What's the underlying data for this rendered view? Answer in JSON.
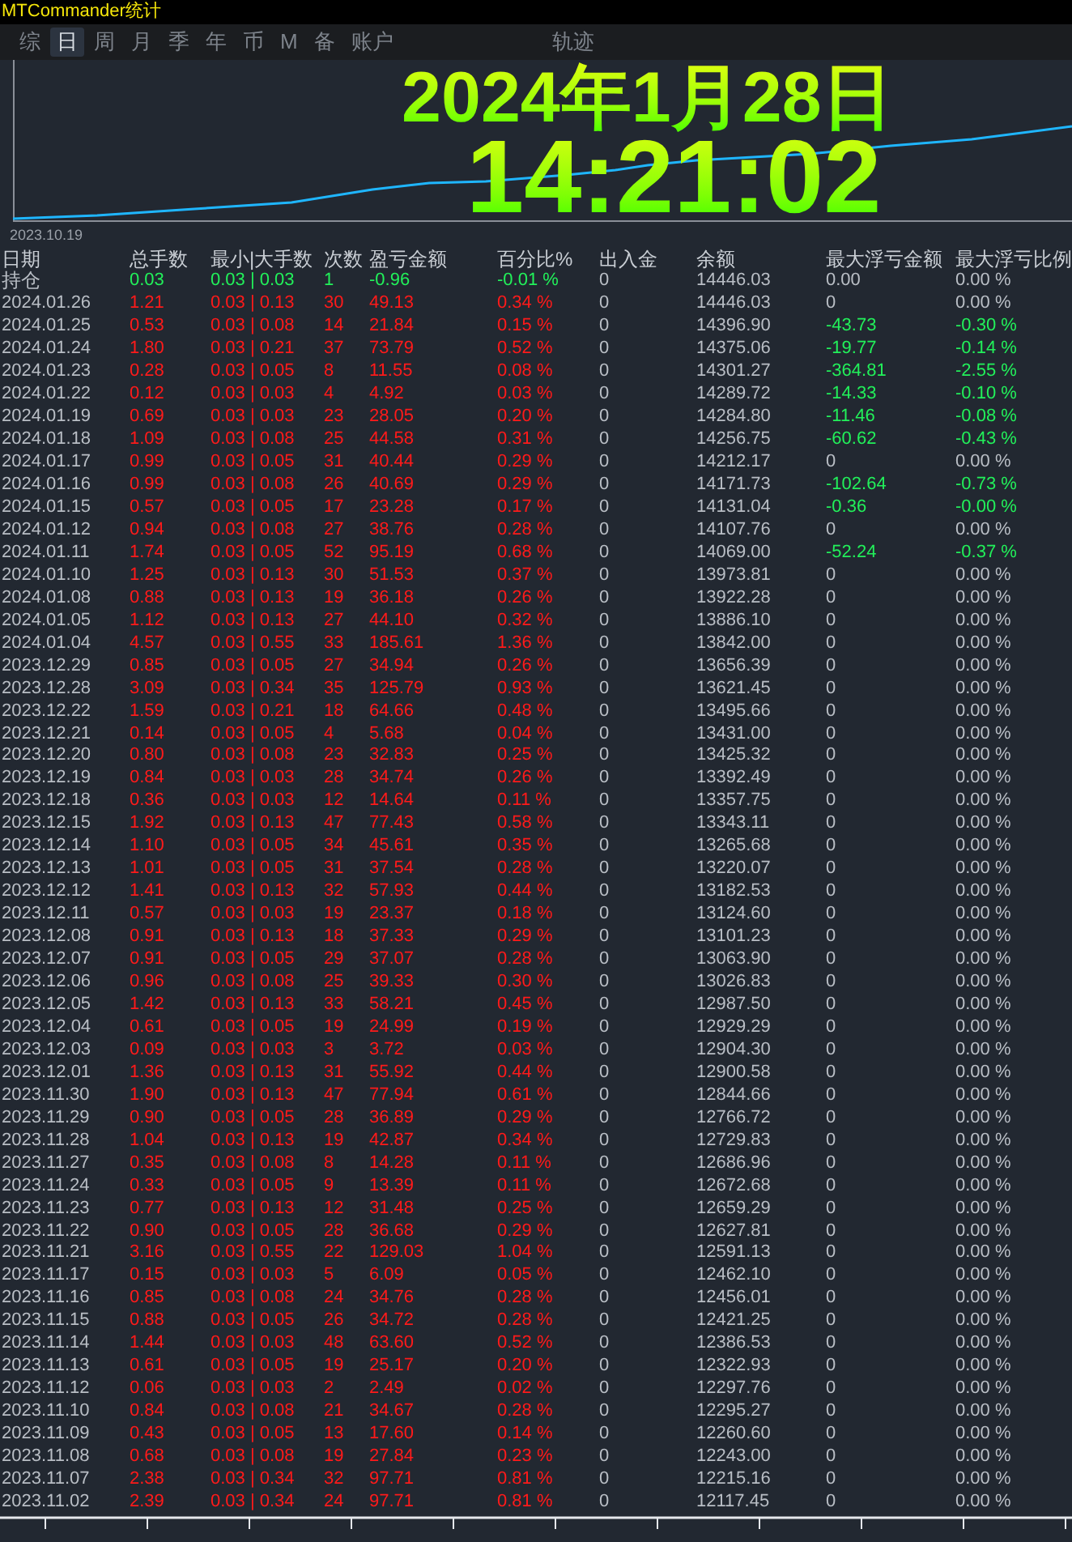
{
  "window": {
    "title": "MTCommander统计"
  },
  "tabs": [
    {
      "label": "综",
      "selected": false
    },
    {
      "label": "日",
      "selected": true
    },
    {
      "label": "周",
      "selected": false
    },
    {
      "label": "月",
      "selected": false
    },
    {
      "label": "季",
      "selected": false
    },
    {
      "label": "年",
      "selected": false
    },
    {
      "label": "币",
      "selected": false
    },
    {
      "label": "M",
      "selected": false
    },
    {
      "label": "备",
      "selected": false
    },
    {
      "label": "账户",
      "selected": false
    },
    {
      "label": "轨迹",
      "selected": false
    }
  ],
  "chart": {
    "start_label": "2023.10.19",
    "date": "2024年1月28日",
    "time": "14:21:02"
  },
  "table": {
    "columns": [
      "日期",
      "总手数",
      "最小|大手数",
      "次数",
      "盈亏金额",
      "百分比%",
      "出入金",
      "余额",
      "最大浮亏金额",
      "最大浮亏比例"
    ],
    "rows": [
      {
        "kind": "position",
        "drawdown": false,
        "cells": [
          "持仓",
          "0.03",
          "0.03 | 0.03",
          "1",
          "-0.96",
          "-0.01 %",
          "0",
          "14446.03",
          "0.00",
          "0.00 %"
        ]
      },
      {
        "kind": "day",
        "drawdown": false,
        "cells": [
          "2024.01.26",
          "1.21",
          "0.03 | 0.13",
          "30",
          "49.13",
          "0.34 %",
          "0",
          "14446.03",
          "0",
          "0.00 %"
        ]
      },
      {
        "kind": "day",
        "drawdown": true,
        "cells": [
          "2024.01.25",
          "0.53",
          "0.03 | 0.08",
          "14",
          "21.84",
          "0.15 %",
          "0",
          "14396.90",
          "-43.73",
          "-0.30 %"
        ]
      },
      {
        "kind": "day",
        "drawdown": true,
        "cells": [
          "2024.01.24",
          "1.80",
          "0.03 | 0.21",
          "37",
          "73.79",
          "0.52 %",
          "0",
          "14375.06",
          "-19.77",
          "-0.14 %"
        ]
      },
      {
        "kind": "day",
        "drawdown": true,
        "cells": [
          "2024.01.23",
          "0.28",
          "0.03 | 0.05",
          "8",
          "11.55",
          "0.08 %",
          "0",
          "14301.27",
          "-364.81",
          "-2.55 %"
        ]
      },
      {
        "kind": "day",
        "drawdown": true,
        "cells": [
          "2024.01.22",
          "0.12",
          "0.03 | 0.03",
          "4",
          "4.92",
          "0.03 %",
          "0",
          "14289.72",
          "-14.33",
          "-0.10 %"
        ]
      },
      {
        "kind": "day",
        "drawdown": true,
        "cells": [
          "2024.01.19",
          "0.69",
          "0.03 | 0.03",
          "23",
          "28.05",
          "0.20 %",
          "0",
          "14284.80",
          "-11.46",
          "-0.08 %"
        ]
      },
      {
        "kind": "day",
        "drawdown": true,
        "cells": [
          "2024.01.18",
          "1.09",
          "0.03 | 0.08",
          "25",
          "44.58",
          "0.31 %",
          "0",
          "14256.75",
          "-60.62",
          "-0.43 %"
        ]
      },
      {
        "kind": "day",
        "drawdown": false,
        "cells": [
          "2024.01.17",
          "0.99",
          "0.03 | 0.05",
          "31",
          "40.44",
          "0.29 %",
          "0",
          "14212.17",
          "0",
          "0.00 %"
        ]
      },
      {
        "kind": "day",
        "drawdown": true,
        "cells": [
          "2024.01.16",
          "0.99",
          "0.03 | 0.08",
          "26",
          "40.69",
          "0.29 %",
          "0",
          "14171.73",
          "-102.64",
          "-0.73 %"
        ]
      },
      {
        "kind": "day",
        "drawdown": true,
        "cells": [
          "2024.01.15",
          "0.57",
          "0.03 | 0.05",
          "17",
          "23.28",
          "0.17 %",
          "0",
          "14131.04",
          "-0.36",
          "-0.00 %"
        ]
      },
      {
        "kind": "day",
        "drawdown": false,
        "cells": [
          "2024.01.12",
          "0.94",
          "0.03 | 0.08",
          "27",
          "38.76",
          "0.28 %",
          "0",
          "14107.76",
          "0",
          "0.00 %"
        ]
      },
      {
        "kind": "day",
        "drawdown": true,
        "cells": [
          "2024.01.11",
          "1.74",
          "0.03 | 0.05",
          "52",
          "95.19",
          "0.68 %",
          "0",
          "14069.00",
          "-52.24",
          "-0.37 %"
        ]
      },
      {
        "kind": "day",
        "drawdown": false,
        "cells": [
          "2024.01.10",
          "1.25",
          "0.03 | 0.13",
          "30",
          "51.53",
          "0.37 %",
          "0",
          "13973.81",
          "0",
          "0.00 %"
        ]
      },
      {
        "kind": "day",
        "drawdown": false,
        "cells": [
          "2024.01.08",
          "0.88",
          "0.03 | 0.13",
          "19",
          "36.18",
          "0.26 %",
          "0",
          "13922.28",
          "0",
          "0.00 %"
        ]
      },
      {
        "kind": "day",
        "drawdown": false,
        "cells": [
          "2024.01.05",
          "1.12",
          "0.03 | 0.13",
          "27",
          "44.10",
          "0.32 %",
          "0",
          "13886.10",
          "0",
          "0.00 %"
        ]
      },
      {
        "kind": "day",
        "drawdown": false,
        "cells": [
          "2024.01.04",
          "4.57",
          "0.03 | 0.55",
          "33",
          "185.61",
          "1.36 %",
          "0",
          "13842.00",
          "0",
          "0.00 %"
        ]
      },
      {
        "kind": "day",
        "drawdown": false,
        "cells": [
          "2023.12.29",
          "0.85",
          "0.03 | 0.05",
          "27",
          "34.94",
          "0.26 %",
          "0",
          "13656.39",
          "0",
          "0.00 %"
        ]
      },
      {
        "kind": "day",
        "drawdown": false,
        "cells": [
          "2023.12.28",
          "3.09",
          "0.03 | 0.34",
          "35",
          "125.79",
          "0.93 %",
          "0",
          "13621.45",
          "0",
          "0.00 %"
        ]
      },
      {
        "kind": "day",
        "drawdown": false,
        "cells": [
          "2023.12.22",
          "1.59",
          "0.03 | 0.21",
          "18",
          "64.66",
          "0.48 %",
          "0",
          "13495.66",
          "0",
          "0.00 %"
        ]
      },
      {
        "kind": "day",
        "drawdown": false,
        "cells": [
          "2023.12.21",
          "0.14",
          "0.03 | 0.05",
          "4",
          "5.68",
          "0.04 %",
          "0",
          "13431.00",
          "0",
          "0.00 %"
        ]
      },
      {
        "kind": "day",
        "drawdown": false,
        "cells": [
          "2023.12.20",
          "0.80",
          "0.03 | 0.08",
          "23",
          "32.83",
          "0.25 %",
          "0",
          "13425.32",
          "0",
          "0.00 %"
        ]
      },
      {
        "kind": "day",
        "drawdown": false,
        "cells": [
          "2023.12.19",
          "0.84",
          "0.03 | 0.03",
          "28",
          "34.74",
          "0.26 %",
          "0",
          "13392.49",
          "0",
          "0.00 %"
        ]
      },
      {
        "kind": "day",
        "drawdown": false,
        "cells": [
          "2023.12.18",
          "0.36",
          "0.03 | 0.03",
          "12",
          "14.64",
          "0.11 %",
          "0",
          "13357.75",
          "0",
          "0.00 %"
        ]
      },
      {
        "kind": "day",
        "drawdown": false,
        "cells": [
          "2023.12.15",
          "1.92",
          "0.03 | 0.13",
          "47",
          "77.43",
          "0.58 %",
          "0",
          "13343.11",
          "0",
          "0.00 %"
        ]
      },
      {
        "kind": "day",
        "drawdown": false,
        "cells": [
          "2023.12.14",
          "1.10",
          "0.03 | 0.05",
          "34",
          "45.61",
          "0.35 %",
          "0",
          "13265.68",
          "0",
          "0.00 %"
        ]
      },
      {
        "kind": "day",
        "drawdown": false,
        "cells": [
          "2023.12.13",
          "1.01",
          "0.03 | 0.05",
          "31",
          "37.54",
          "0.28 %",
          "0",
          "13220.07",
          "0",
          "0.00 %"
        ]
      },
      {
        "kind": "day",
        "drawdown": false,
        "cells": [
          "2023.12.12",
          "1.41",
          "0.03 | 0.13",
          "32",
          "57.93",
          "0.44 %",
          "0",
          "13182.53",
          "0",
          "0.00 %"
        ]
      },
      {
        "kind": "day",
        "drawdown": false,
        "cells": [
          "2023.12.11",
          "0.57",
          "0.03 | 0.03",
          "19",
          "23.37",
          "0.18 %",
          "0",
          "13124.60",
          "0",
          "0.00 %"
        ]
      },
      {
        "kind": "day",
        "drawdown": false,
        "cells": [
          "2023.12.08",
          "0.91",
          "0.03 | 0.13",
          "18",
          "37.33",
          "0.29 %",
          "0",
          "13101.23",
          "0",
          "0.00 %"
        ]
      },
      {
        "kind": "day",
        "drawdown": false,
        "cells": [
          "2023.12.07",
          "0.91",
          "0.03 | 0.05",
          "29",
          "37.07",
          "0.28 %",
          "0",
          "13063.90",
          "0",
          "0.00 %"
        ]
      },
      {
        "kind": "day",
        "drawdown": false,
        "cells": [
          "2023.12.06",
          "0.96",
          "0.03 | 0.08",
          "25",
          "39.33",
          "0.30 %",
          "0",
          "13026.83",
          "0",
          "0.00 %"
        ]
      },
      {
        "kind": "day",
        "drawdown": false,
        "cells": [
          "2023.12.05",
          "1.42",
          "0.03 | 0.13",
          "33",
          "58.21",
          "0.45 %",
          "0",
          "12987.50",
          "0",
          "0.00 %"
        ]
      },
      {
        "kind": "day",
        "drawdown": false,
        "cells": [
          "2023.12.04",
          "0.61",
          "0.03 | 0.05",
          "19",
          "24.99",
          "0.19 %",
          "0",
          "12929.29",
          "0",
          "0.00 %"
        ]
      },
      {
        "kind": "day",
        "drawdown": false,
        "cells": [
          "2023.12.03",
          "0.09",
          "0.03 | 0.03",
          "3",
          "3.72",
          "0.03 %",
          "0",
          "12904.30",
          "0",
          "0.00 %"
        ]
      },
      {
        "kind": "day",
        "drawdown": false,
        "cells": [
          "2023.12.01",
          "1.36",
          "0.03 | 0.13",
          "31",
          "55.92",
          "0.44 %",
          "0",
          "12900.58",
          "0",
          "0.00 %"
        ]
      },
      {
        "kind": "day",
        "drawdown": false,
        "cells": [
          "2023.11.30",
          "1.90",
          "0.03 | 0.13",
          "47",
          "77.94",
          "0.61 %",
          "0",
          "12844.66",
          "0",
          "0.00 %"
        ]
      },
      {
        "kind": "day",
        "drawdown": false,
        "cells": [
          "2023.11.29",
          "0.90",
          "0.03 | 0.05",
          "28",
          "36.89",
          "0.29 %",
          "0",
          "12766.72",
          "0",
          "0.00 %"
        ]
      },
      {
        "kind": "day",
        "drawdown": false,
        "cells": [
          "2023.11.28",
          "1.04",
          "0.03 | 0.13",
          "19",
          "42.87",
          "0.34 %",
          "0",
          "12729.83",
          "0",
          "0.00 %"
        ]
      },
      {
        "kind": "day",
        "drawdown": false,
        "cells": [
          "2023.11.27",
          "0.35",
          "0.03 | 0.08",
          "8",
          "14.28",
          "0.11 %",
          "0",
          "12686.96",
          "0",
          "0.00 %"
        ]
      },
      {
        "kind": "day",
        "drawdown": false,
        "cells": [
          "2023.11.24",
          "0.33",
          "0.03 | 0.05",
          "9",
          "13.39",
          "0.11 %",
          "0",
          "12672.68",
          "0",
          "0.00 %"
        ]
      },
      {
        "kind": "day",
        "drawdown": false,
        "cells": [
          "2023.11.23",
          "0.77",
          "0.03 | 0.13",
          "12",
          "31.48",
          "0.25 %",
          "0",
          "12659.29",
          "0",
          "0.00 %"
        ]
      },
      {
        "kind": "day",
        "drawdown": false,
        "cells": [
          "2023.11.22",
          "0.90",
          "0.03 | 0.05",
          "28",
          "36.68",
          "0.29 %",
          "0",
          "12627.81",
          "0",
          "0.00 %"
        ]
      },
      {
        "kind": "day",
        "drawdown": false,
        "cells": [
          "2023.11.21",
          "3.16",
          "0.03 | 0.55",
          "22",
          "129.03",
          "1.04 %",
          "0",
          "12591.13",
          "0",
          "0.00 %"
        ]
      },
      {
        "kind": "day",
        "drawdown": false,
        "cells": [
          "2023.11.17",
          "0.15",
          "0.03 | 0.03",
          "5",
          "6.09",
          "0.05 %",
          "0",
          "12462.10",
          "0",
          "0.00 %"
        ]
      },
      {
        "kind": "day",
        "drawdown": false,
        "cells": [
          "2023.11.16",
          "0.85",
          "0.03 | 0.08",
          "24",
          "34.76",
          "0.28 %",
          "0",
          "12456.01",
          "0",
          "0.00 %"
        ]
      },
      {
        "kind": "day",
        "drawdown": false,
        "cells": [
          "2023.11.15",
          "0.88",
          "0.03 | 0.05",
          "26",
          "34.72",
          "0.28 %",
          "0",
          "12421.25",
          "0",
          "0.00 %"
        ]
      },
      {
        "kind": "day",
        "drawdown": false,
        "cells": [
          "2023.11.14",
          "1.44",
          "0.03 | 0.03",
          "48",
          "63.60",
          "0.52 %",
          "0",
          "12386.53",
          "0",
          "0.00 %"
        ]
      },
      {
        "kind": "day",
        "drawdown": false,
        "cells": [
          "2023.11.13",
          "0.61",
          "0.03 | 0.05",
          "19",
          "25.17",
          "0.20 %",
          "0",
          "12322.93",
          "0",
          "0.00 %"
        ]
      },
      {
        "kind": "day",
        "drawdown": false,
        "cells": [
          "2023.11.12",
          "0.06",
          "0.03 | 0.03",
          "2",
          "2.49",
          "0.02 %",
          "0",
          "12297.76",
          "0",
          "0.00 %"
        ]
      },
      {
        "kind": "day",
        "drawdown": false,
        "cells": [
          "2023.11.10",
          "0.84",
          "0.03 | 0.08",
          "21",
          "34.67",
          "0.28 %",
          "0",
          "12295.27",
          "0",
          "0.00 %"
        ]
      },
      {
        "kind": "day",
        "drawdown": false,
        "cells": [
          "2023.11.09",
          "0.43",
          "0.03 | 0.05",
          "13",
          "17.60",
          "0.14 %",
          "0",
          "12260.60",
          "0",
          "0.00 %"
        ]
      },
      {
        "kind": "day",
        "drawdown": false,
        "cells": [
          "2023.11.08",
          "0.68",
          "0.03 | 0.08",
          "19",
          "27.84",
          "0.23 %",
          "0",
          "12243.00",
          "0",
          "0.00 %"
        ]
      },
      {
        "kind": "day",
        "drawdown": false,
        "cells": [
          "2023.11.07",
          "2.38",
          "0.03 | 0.34",
          "32",
          "97.71",
          "0.81 %",
          "0",
          "12215.16",
          "0",
          "0.00 %"
        ]
      },
      {
        "kind": "day",
        "drawdown": false,
        "cells": [
          "2023.11.02",
          "2.39",
          "0.03 | 0.34",
          "24",
          "97.71",
          "0.81 %",
          "0",
          "12117.45",
          "0",
          "0.00 %"
        ]
      }
    ]
  }
}
